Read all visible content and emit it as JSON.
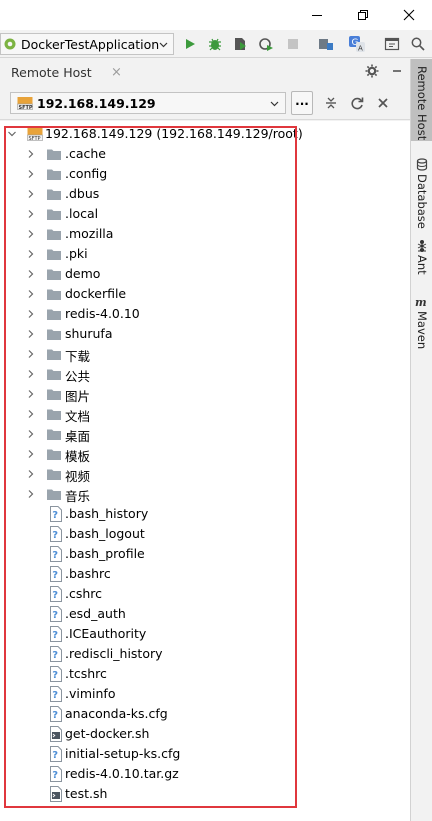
{
  "toolbar": {
    "run_config_label": "DockerTestApplication"
  },
  "tool_window": {
    "tab_label": "Remote Host",
    "tab_close": "×",
    "host_selected": "192.168.149.129",
    "browse_label": "..."
  },
  "tree": {
    "root_label": "192.168.149.129 (192.168.149.129/root)",
    "folders": [
      ".cache",
      ".config",
      ".dbus",
      ".local",
      ".mozilla",
      ".pki",
      "demo",
      "dockerfile",
      "redis-4.0.10",
      "shurufa",
      "下载",
      "公共",
      "图片",
      "文档",
      "桌面",
      "模板",
      "视频",
      "音乐"
    ],
    "files": [
      {
        "name": ".bash_history",
        "type": "unknown"
      },
      {
        "name": ".bash_logout",
        "type": "unknown"
      },
      {
        "name": ".bash_profile",
        "type": "unknown"
      },
      {
        "name": ".bashrc",
        "type": "unknown"
      },
      {
        "name": ".cshrc",
        "type": "unknown"
      },
      {
        "name": ".esd_auth",
        "type": "unknown"
      },
      {
        "name": ".ICEauthority",
        "type": "unknown"
      },
      {
        "name": ".rediscli_history",
        "type": "unknown"
      },
      {
        "name": ".tcshrc",
        "type": "unknown"
      },
      {
        "name": ".viminfo",
        "type": "unknown"
      },
      {
        "name": "anaconda-ks.cfg",
        "type": "unknown"
      },
      {
        "name": "get-docker.sh",
        "type": "shell"
      },
      {
        "name": "initial-setup-ks.cfg",
        "type": "unknown"
      },
      {
        "name": "redis-4.0.10.tar.gz",
        "type": "unknown"
      },
      {
        "name": "test.sh",
        "type": "shell"
      }
    ]
  },
  "side_stripe": {
    "items": [
      {
        "label": "Remote Host",
        "icon": "none",
        "active": true
      },
      {
        "label": "Database",
        "icon": "database-icon",
        "active": false
      },
      {
        "label": "Ant",
        "icon": "ant-icon",
        "active": false
      },
      {
        "label": "Maven",
        "icon": "maven-icon",
        "active": false
      }
    ]
  },
  "colors": {
    "highlight_box": "#e0373d",
    "run_green": "#3c9a3c",
    "folder_gray": "#9aa4ad",
    "active_stripe_tab": "#bfbfbf"
  }
}
